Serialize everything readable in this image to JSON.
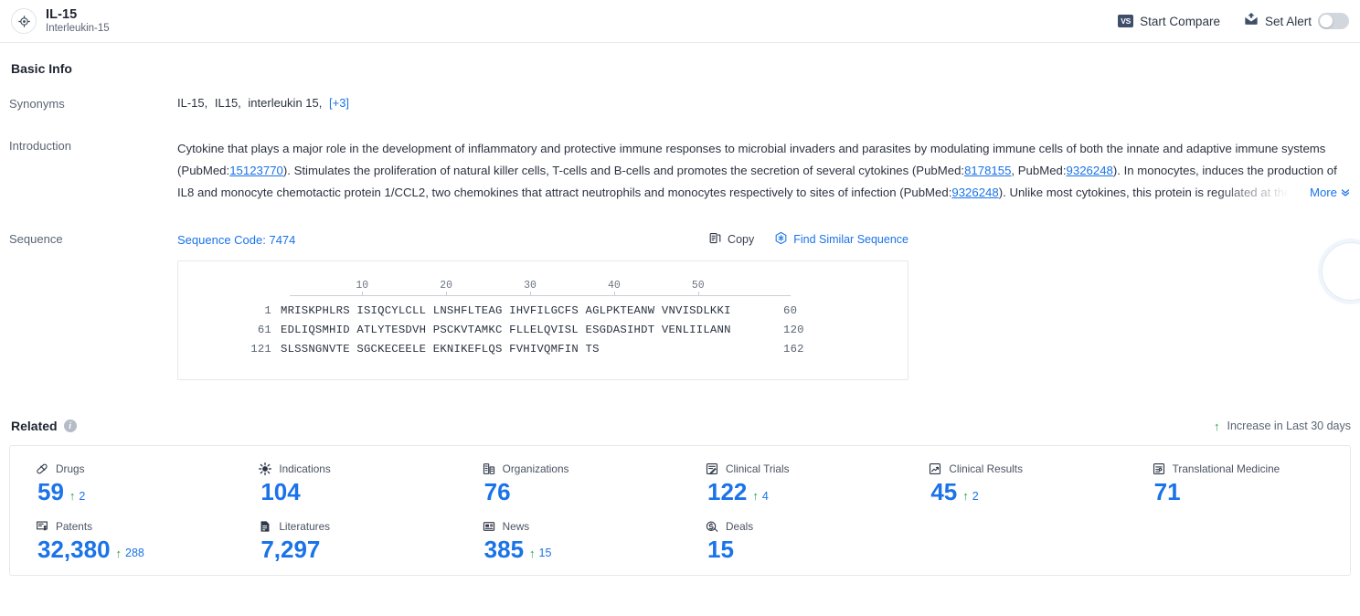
{
  "header": {
    "avatar_icon": "target-crosshair-icon",
    "title": "IL-15",
    "subtitle": "Interleukin-15",
    "compare": {
      "badge": "VS",
      "label": "Start Compare"
    },
    "alert": {
      "icon": "alert-envelope-icon",
      "label": "Set Alert",
      "toggle_on": false
    }
  },
  "basic_info": {
    "section_title": "Basic Info",
    "synonyms": {
      "label": "Synonyms",
      "items": [
        "IL-15,",
        "IL15,",
        "interleukin 15,"
      ],
      "more": "[+3]"
    },
    "introduction": {
      "label": "Introduction",
      "p1": "Cytokine that plays a major role in the development of inflammatory and protective immune responses to microbial invaders and parasites by modulating immune cells of both the innate and adaptive immune systems (PubMed:",
      "ref1": "15123770",
      "p2": "). Stimulates the proliferation of natural killer cells, T-cells and B-cells and promotes the secretion of several cytokines (PubMed:",
      "ref2": "8178155",
      "p3": ", PubMed:",
      "ref3": "9326248",
      "p4": "). In monocytes, induces the production of IL8 and monocyte chemotactic protein 1/CCL2, two chemokines that attract neutrophils and monocytes respectively to sites of infection (PubMed:",
      "ref4": "9326248",
      "p5": "). Unlike most cytokines, this protein is regulated at the levels of transcription, translation and intracellular trafficking.",
      "more_label": "More",
      "more_chevron": "chevron-double-down-icon"
    },
    "sequence": {
      "label": "Sequence",
      "code_label": "Sequence Code: 7474",
      "copy": {
        "icon": "copy-icon",
        "label": "Copy"
      },
      "find_similar": {
        "icon": "similar-sequence-icon",
        "label": "Find Similar Sequence"
      },
      "ruler_ticks": [
        "10",
        "20",
        "30",
        "40",
        "50"
      ],
      "lines": [
        {
          "start": "1",
          "residues": "MRISKPHLRS ISIQCYLCLL LNSHFLTEAG IHVFILGCFS AGLPKTEANW VNVISDLKKI",
          "end": "60"
        },
        {
          "start": "61",
          "residues": "EDLIQSMHID ATLYTESDVH PSCKVTAMKC FLLELQVISL ESGDASIHDT VENLIILANN",
          "end": "120"
        },
        {
          "start": "121",
          "residues": "SLSSNGNVTE SGCKECEELE EKNIKEFLQS FVHIVQMFIN TS",
          "end": "162"
        }
      ]
    }
  },
  "related": {
    "section_title": "Related",
    "info_icon": "info-icon",
    "info_glyph": "i",
    "increase_note": {
      "arrow": "arrow-up-icon",
      "label": "Increase in Last 30 days"
    },
    "metrics": [
      {
        "icon": "pill-icon",
        "label": "Drugs",
        "value": "59",
        "delta": "2"
      },
      {
        "icon": "virus-icon",
        "label": "Indications",
        "value": "104",
        "delta": ""
      },
      {
        "icon": "organization-icon",
        "label": "Organizations",
        "value": "76",
        "delta": ""
      },
      {
        "icon": "clinical-trial-icon",
        "label": "Clinical Trials",
        "value": "122",
        "delta": "4"
      },
      {
        "icon": "clinical-result-icon",
        "label": "Clinical Results",
        "value": "45",
        "delta": "2"
      },
      {
        "icon": "translational-icon",
        "label": "Translational Medicine",
        "value": "71",
        "delta": ""
      },
      {
        "icon": "patent-icon",
        "label": "Patents",
        "value": "32,380",
        "delta": "288"
      },
      {
        "icon": "literature-icon",
        "label": "Literatures",
        "value": "7,297",
        "delta": ""
      },
      {
        "icon": "news-icon",
        "label": "News",
        "value": "385",
        "delta": "15"
      },
      {
        "icon": "deal-icon",
        "label": "Deals",
        "value": "15",
        "delta": ""
      }
    ]
  },
  "colors": {
    "accent_blue": "#1a73e8",
    "increase_green": "#22a347",
    "text_dark": "#1e2430",
    "text_muted": "#5a6473",
    "border": "#e6e8ec"
  }
}
